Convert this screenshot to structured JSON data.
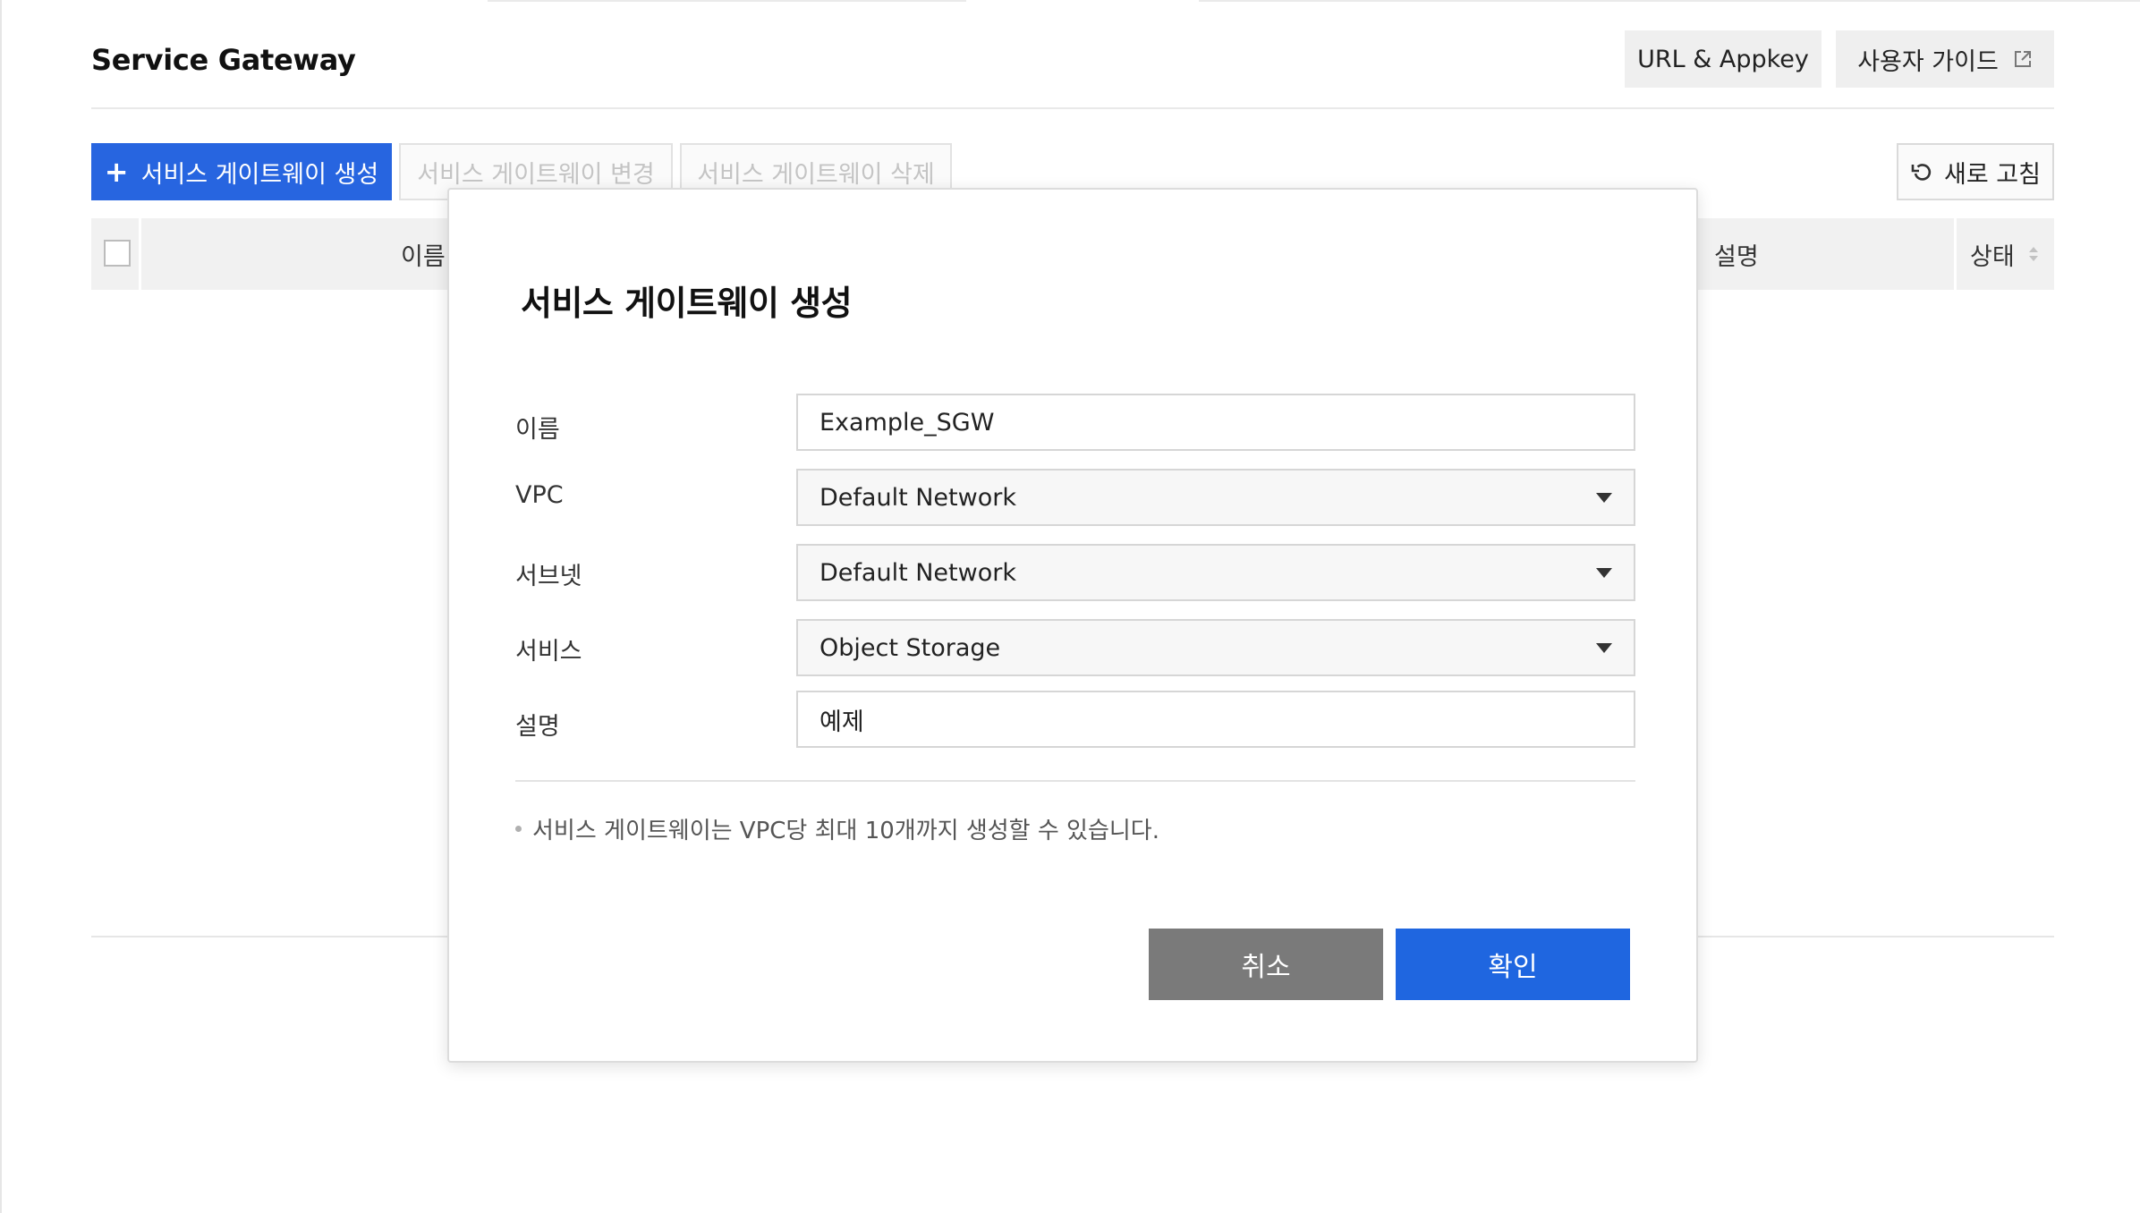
{
  "header": {
    "title": "Service Gateway",
    "url_appkey_label": "URL & Appkey",
    "user_guide_label": "사용자 가이드"
  },
  "toolbar": {
    "create_label": "서비스 게이트웨이 생성",
    "change_label": "서비스 게이트웨이 변경",
    "delete_label": "서비스 게이트웨이 삭제",
    "refresh_label": "새로 고침"
  },
  "table": {
    "columns": [
      "이름",
      "설명",
      "상태"
    ]
  },
  "modal": {
    "title": "서비스 게이트웨이 생성",
    "fields": [
      {
        "label": "이름",
        "value": "Example_SGW",
        "type": "text"
      },
      {
        "label": "VPC",
        "value": "Default Network",
        "type": "select"
      },
      {
        "label": "서브넷",
        "value": "Default Network",
        "type": "select"
      },
      {
        "label": "서비스",
        "value": "Object Storage",
        "type": "select"
      },
      {
        "label": "설명",
        "value": "예제",
        "type": "text"
      }
    ],
    "note": "서비스 게이트웨이는 VPC당 최대 10개까지 생성할 수 있습니다.",
    "cancel_label": "취소",
    "confirm_label": "확인"
  },
  "colors": {
    "primary": "#2765e0",
    "cancel": "#7a7a7a",
    "header_bg": "#f1f1f1"
  },
  "icons": {
    "create": "plus-icon",
    "refresh": "refresh-icon",
    "guide": "external-link-icon",
    "sort": "sort-icon",
    "select": "caret-down-icon"
  }
}
